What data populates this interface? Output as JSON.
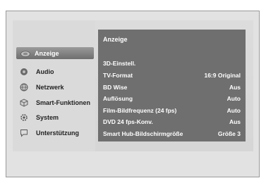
{
  "sidebar": {
    "items": [
      {
        "label": "Anzeige",
        "icon": "display-icon",
        "active": true
      },
      {
        "label": "Audio",
        "icon": "speaker-icon"
      },
      {
        "label": "Netzwerk",
        "icon": "network-globe-icon"
      },
      {
        "label": "Smart-Funktionen",
        "icon": "cube-icon"
      },
      {
        "label": "System",
        "icon": "gear-icon"
      },
      {
        "label": "Unterstützung",
        "icon": "speech-bubble-icon"
      }
    ]
  },
  "panel": {
    "title": "Anzeige",
    "rows": [
      {
        "label": "3D-Einstell.",
        "value": ""
      },
      {
        "label": "TV-Format",
        "value": "16:9 Original"
      },
      {
        "label": "BD Wise",
        "value": "Aus"
      },
      {
        "label": "Auflösung",
        "value": "Auto"
      },
      {
        "label": "Film-Bildfrequenz (24 fps)",
        "value": "Auto"
      },
      {
        "label": "DVD 24 fps-Konv.",
        "value": "Aus"
      },
      {
        "label": "Smart Hub-Bildschirmgröße",
        "value": "Größe 3"
      }
    ]
  }
}
